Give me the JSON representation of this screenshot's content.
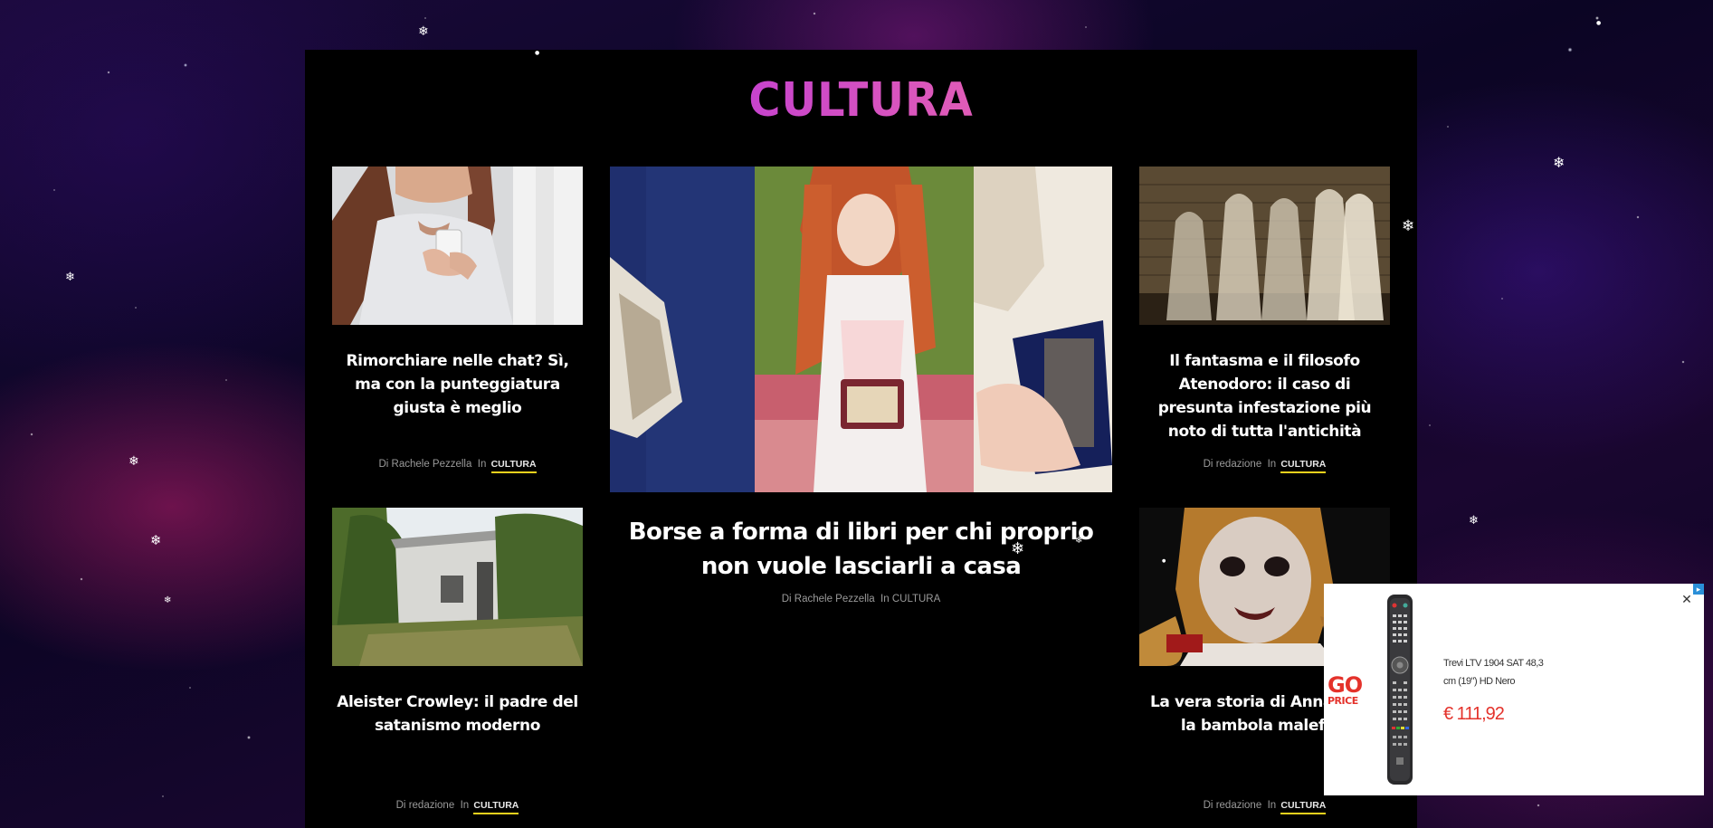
{
  "section": {
    "title": "CULTURA"
  },
  "articles": [
    {
      "title": "Rimorchiare nelle chat? Sì, ma con la punteggiatura giusta è meglio",
      "by_prefix": "Di",
      "author": "Rachele Pezzella",
      "in_label": "In",
      "category": "CULTURA"
    },
    {
      "title": "Il fantasma e il filosofo Atenodoro: il caso di presunta infestazione più noto di tutta l'antichità",
      "by_prefix": "Di",
      "author": "redazione",
      "in_label": "In",
      "category": "CULTURA"
    },
    {
      "title": "Aleister Crowley: il padre del satanismo moderno",
      "by_prefix": "Di",
      "author": "redazione",
      "in_label": "In",
      "category": "CULTURA"
    },
    {
      "title": "La vera storia di Annabelle, la bambola malefica",
      "by_prefix": "Di",
      "author": "redazione",
      "in_label": "In",
      "category": "CULTURA"
    }
  ],
  "featured": {
    "title": "Borse a forma di libri per chi proprio non vuole lasciarli a casa",
    "by_prefix": "Di",
    "author": "Rachele Pezzella",
    "in_label": "In",
    "category": "CULTURA"
  },
  "ad": {
    "logo_top": "GO",
    "logo_bottom": "PRICE",
    "product_line1": "Trevi LTV 1904 SAT 48,3",
    "product_line2": "cm (19\") HD Nero",
    "price": "€ 111,92",
    "close_glyph": "✕",
    "info_glyph": "▸",
    "accent_color": "#e4322b"
  },
  "colors": {
    "category_underline": "#f2d21d",
    "title_gradient": [
      "#8a46d8",
      "#c23fd1",
      "#e05bb8"
    ]
  }
}
